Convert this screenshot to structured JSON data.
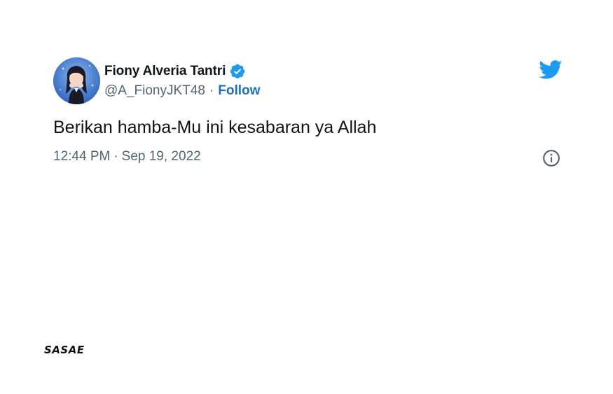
{
  "author": {
    "display_name": "Fiony Alveria Tantri",
    "handle": "@A_FionyJKT48",
    "separator": "·",
    "follow_label": "Follow",
    "verified": true
  },
  "tweet": {
    "text": "Berikan hamba-Mu ini kesabaran ya Allah",
    "time": "12:44 PM",
    "separator": "·",
    "date": "Sep 19, 2022"
  },
  "icons": {
    "platform_logo": "twitter-bird-icon",
    "verified": "verified-badge-icon",
    "info": "info-icon"
  },
  "watermark": {
    "text": "SASAE"
  },
  "colors": {
    "twitter_blue": "#1d9bf0",
    "follow_link": "#1d6fbd",
    "text_primary": "#0f1419",
    "text_secondary": "#536471",
    "avatar_bg": "#4a7fd0"
  }
}
